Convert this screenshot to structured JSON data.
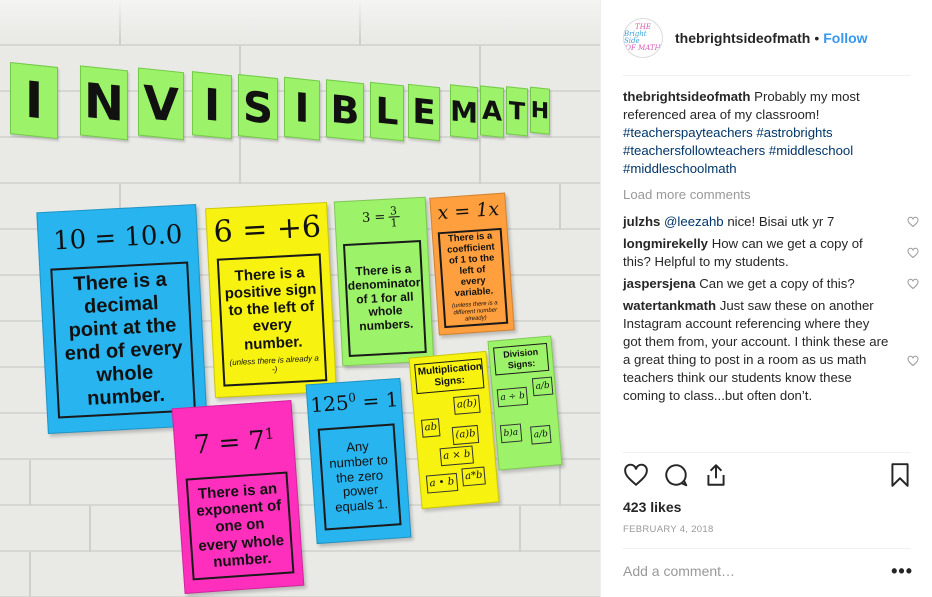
{
  "post": {
    "photo": {
      "banner_letters": [
        "I",
        "N",
        "V",
        "I",
        "S",
        "I",
        "B",
        "L",
        "E",
        "M",
        "A",
        "T",
        "H"
      ],
      "cards": {
        "decimal": {
          "equation": "10 = 10.0",
          "text": "There is a decimal point at the end of every whole number."
        },
        "sign": {
          "equation": "6 = +6",
          "text": "There is a positive sign to the left of every number.",
          "note": "(unless there is already a -)"
        },
        "denominator": {
          "equation_left": "3 =",
          "equation_num": "3",
          "equation_den": "1",
          "text": "There is a denominator of 1 for all whole numbers."
        },
        "coefficient": {
          "equation": "x = 1x",
          "text": "There is a coefficient of 1 to the left of every variable.",
          "note": "(unless there is a different number already)"
        },
        "exponent": {
          "equation_base": "7 = 7",
          "equation_sup": "1",
          "text": "There is an exponent of one on every whole number."
        },
        "zero_power": {
          "equation_base": "125",
          "equation_sup": "0",
          "equation_rest": " = 1",
          "text": "Any number to the zero power equals 1."
        },
        "multiplication": {
          "title": "Multiplication Signs:",
          "ops": [
            "a(b)",
            "ab",
            "(a)b",
            "a × b",
            "a • b",
            "a*b"
          ]
        },
        "division": {
          "title": "Division Signs:",
          "ops": [
            "a ÷ b",
            "a/b",
            "b)a",
            "a/b"
          ]
        }
      }
    },
    "header": {
      "username": "thebrightsideofmath",
      "separator": "•",
      "follow_label": "Follow",
      "avatar_text_1": "THE",
      "avatar_text_2": "Bright Side",
      "avatar_text_3": "OF MATH"
    },
    "caption": {
      "username": "thebrightsideofmath",
      "text": "Probably my most referenced area of my classroom!",
      "hashtags": "#teacherspayteachers #astrobrights #teachersfollowteachers #middleschool #middleschoolmath"
    },
    "load_more_label": "Load more comments",
    "comments": [
      {
        "user": "julzhs",
        "mention": "@leezahb",
        "text": "nice! Bisai utk yr 7"
      },
      {
        "user": "longmirekelly",
        "mention": "",
        "text": "How can we get a copy of this? Helpful to my students."
      },
      {
        "user": "jaspersjena",
        "mention": "",
        "text": "Can we get a copy of this?"
      },
      {
        "user": "watertankmath",
        "mention": "",
        "text": "Just saw these on another Instagram account referencing where they got them from, your account. I think these are a great thing to post in a room as us math teachers think our students know these coming to class...but often don’t."
      }
    ],
    "likes": "423 likes",
    "date": "FEBRUARY 4, 2018",
    "add_comment_placeholder": "Add a comment…",
    "more_options": "•••",
    "icons": [
      "heart-icon",
      "comment-icon",
      "share-icon",
      "bookmark-icon"
    ],
    "colors": {
      "follow": "#3897f0",
      "hashtag": "#003569",
      "muted": "#999999",
      "card_blue": "#27b4ef",
      "card_yellow": "#f7f20f",
      "card_green": "#9cf36a",
      "card_orange": "#ff9f3d",
      "card_pink": "#ff2fbe"
    }
  }
}
